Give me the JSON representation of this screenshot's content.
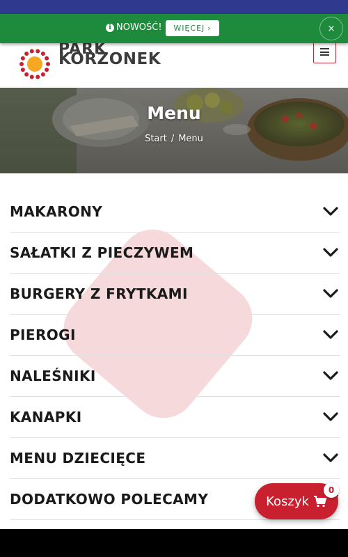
{
  "notice": {
    "icon": "info-icon",
    "text": "NOWOŚĆ!",
    "button_label": "WIĘCEJ",
    "close_label": "×"
  },
  "brand": {
    "name_line1": "PARK",
    "name_line2": "KORZONEK",
    "accent_color": "#c8202e",
    "sun_color": "#f7a823"
  },
  "header": {
    "menu_icon": "hamburger-icon"
  },
  "hero": {
    "title": "Menu",
    "breadcrumb": {
      "home": "Start",
      "separator": "/",
      "current": "Menu"
    }
  },
  "categories": [
    {
      "label": "MAKARONY"
    },
    {
      "label": "SAŁATKI Z PIECZYWEM"
    },
    {
      "label": "BURGERY Z FRYTKAMI"
    },
    {
      "label": "PIEROGI"
    },
    {
      "label": "NALEŚNIKI"
    },
    {
      "label": "KANAPKI"
    },
    {
      "label": "MENU DZIECIĘCE"
    },
    {
      "label": "DODATKOWO POLECAMY"
    }
  ],
  "cart": {
    "label": "Koszyk",
    "icon": "cart-icon",
    "count": "0"
  },
  "colors": {
    "notice_bg": "#1e8a3c",
    "top_strip": "#2f3a8f",
    "cart_bg": "#c8202e"
  }
}
